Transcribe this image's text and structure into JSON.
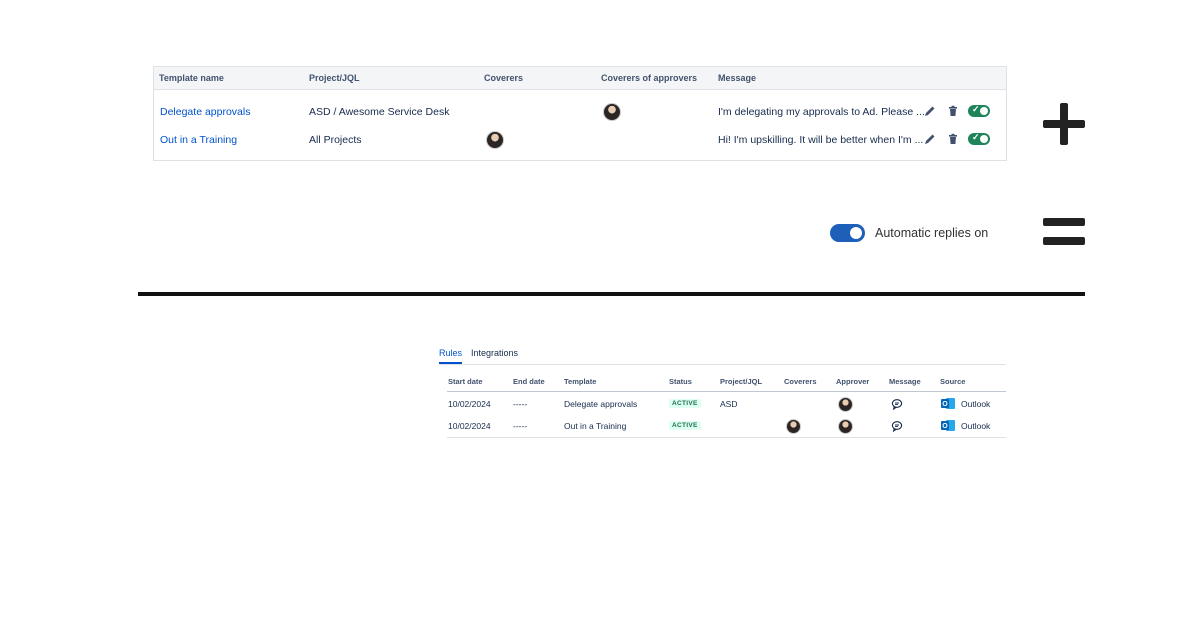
{
  "templates_table": {
    "headers": [
      "Template name",
      "Project/JQL",
      "Coverers",
      "Coverers of approvers",
      "Message"
    ],
    "rows": [
      {
        "template_name": "Delegate approvals",
        "project": "ASD / Awesome Service Desk",
        "message": "I'm delegating my approvals to Ad. Please ..."
      },
      {
        "template_name": "Out in a Training",
        "project": "All Projects",
        "message": "Hi! I'm upskilling. It will be better when I'm ..."
      }
    ],
    "icons": [
      "pencil-icon",
      "trash-icon",
      "toggle-on"
    ],
    "toggle_color": "#1f845a"
  },
  "operators": {
    "plus": "plus-icon",
    "equals": "equals-icon"
  },
  "auto_replies": {
    "label": "Automatic replies on",
    "toggle_color": "#1e5fba"
  },
  "rules_panel": {
    "tabs": [
      "Rules",
      "Integrations"
    ],
    "headers": [
      "Start date",
      "End date",
      "Template",
      "Status",
      "Project/JQL",
      "Coverers",
      "Approver",
      "Message",
      "Source"
    ],
    "rows": [
      {
        "start_date": "10/02/2024",
        "end_date": "-----",
        "template": "Delegate approvals",
        "status": "ACTIVE",
        "project": "ASD",
        "source": "Outlook"
      },
      {
        "start_date": "10/02/2024",
        "end_date": "-----",
        "template": "Out in a Training",
        "status": "ACTIVE",
        "project": "",
        "source": "Outlook"
      }
    ],
    "accent_color": "#0052cc",
    "status_color": "#216e4e"
  }
}
